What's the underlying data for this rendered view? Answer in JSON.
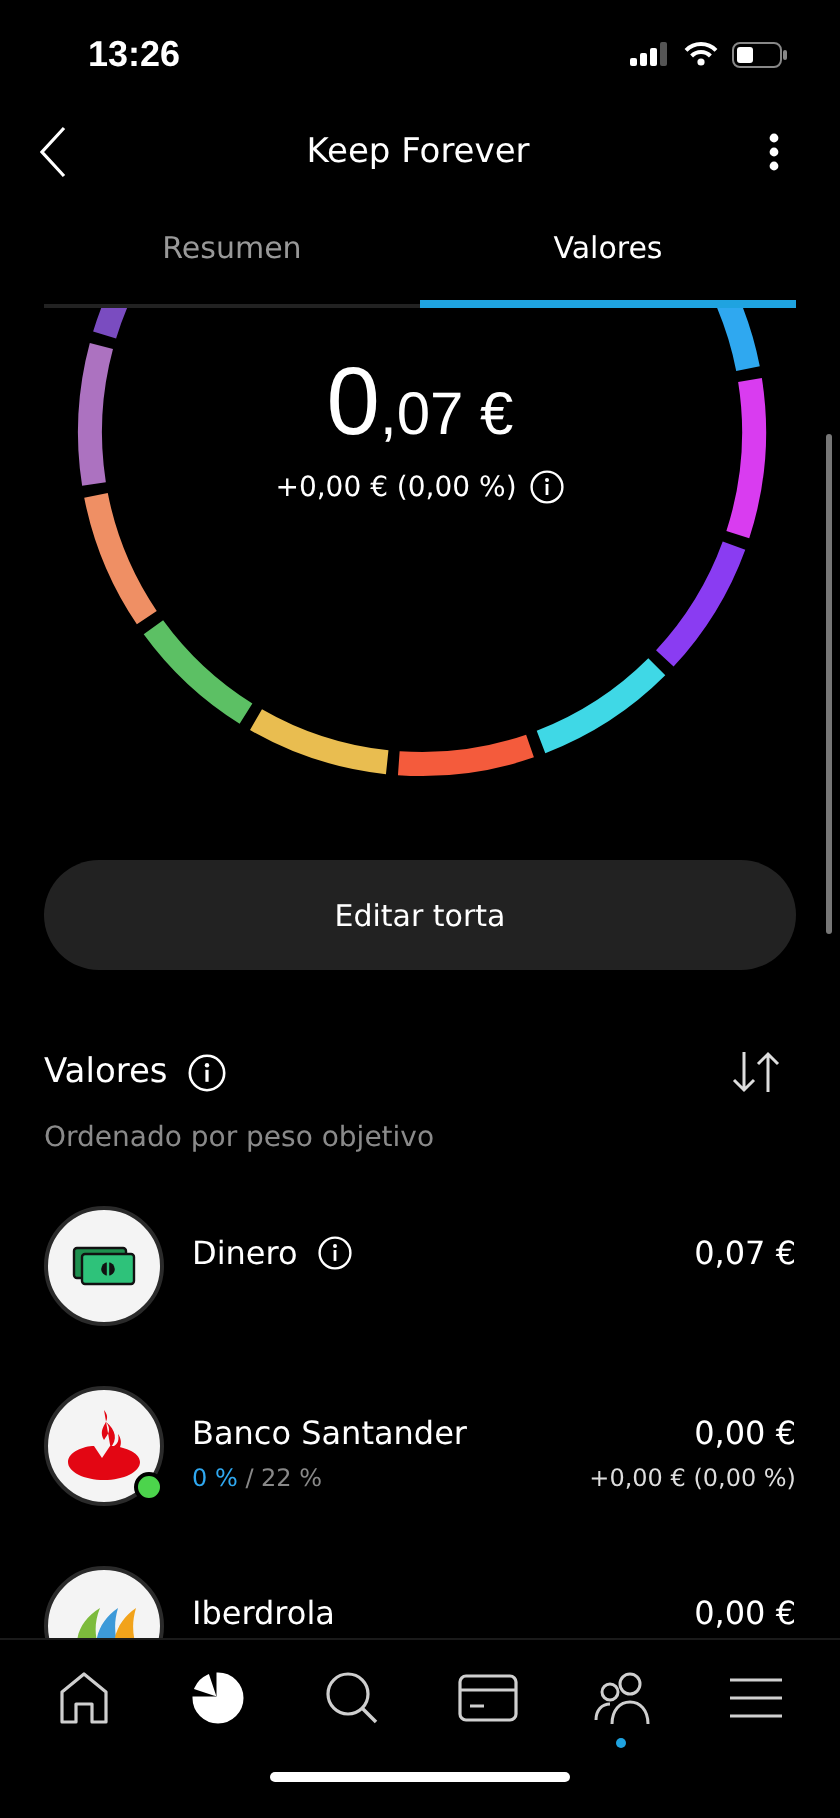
{
  "status_bar": {
    "time": "13:26"
  },
  "header": {
    "title": "Keep Forever"
  },
  "tabs": [
    {
      "label": "Resumen",
      "selected": false
    },
    {
      "label": "Valores",
      "selected": true
    }
  ],
  "portfolio": {
    "total_units": "0",
    "total_cents": ",07 €",
    "change": "+0,00 € (0,00 %)"
  },
  "edit_button": "Editar torta",
  "holdings_section": {
    "title": "Valores",
    "subtitle": "Ordenado por peso objetivo"
  },
  "holdings": [
    {
      "kind": "cash",
      "name": "Dinero",
      "value": "0,07 €"
    },
    {
      "kind": "santander",
      "name": "Banco Santander",
      "current_weight": "0 %",
      "target_weight": "/ 22 %",
      "value": "0,00 €",
      "change": "+0,00 € (0,00 %)",
      "online": true
    },
    {
      "kind": "iberdrola",
      "name": "Iberdrola",
      "value": "0,00 €"
    }
  ],
  "nav": [
    {
      "kind": "home",
      "selected": false,
      "badge": false
    },
    {
      "kind": "portfolio",
      "selected": true,
      "badge": false
    },
    {
      "kind": "search",
      "selected": false,
      "badge": false
    },
    {
      "kind": "card",
      "selected": false,
      "badge": false
    },
    {
      "kind": "people",
      "selected": false,
      "badge": true
    },
    {
      "kind": "menu",
      "selected": false,
      "badge": false
    }
  ]
}
